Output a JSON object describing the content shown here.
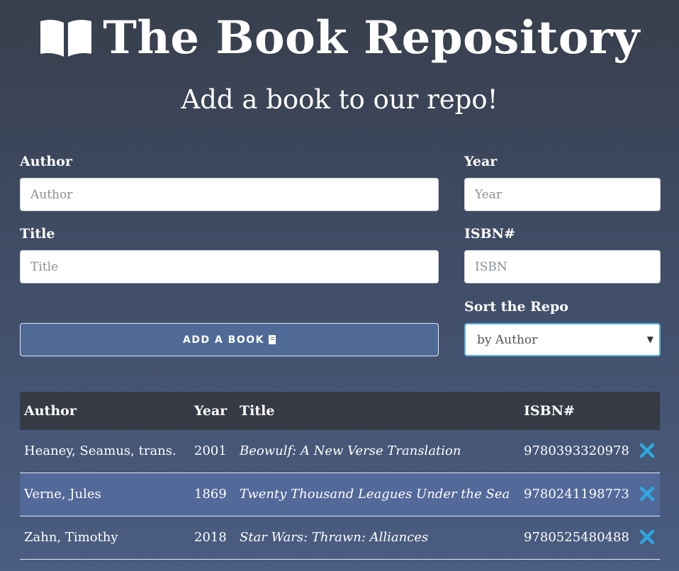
{
  "header": {
    "title": "The Book Repository",
    "subtitle": "Add a book to our repo!",
    "icon": "open-book-icon"
  },
  "form": {
    "author": {
      "label": "Author",
      "placeholder": "Author",
      "value": ""
    },
    "year": {
      "label": "Year",
      "placeholder": "Year",
      "value": ""
    },
    "title": {
      "label": "Title",
      "placeholder": "Title",
      "value": ""
    },
    "isbn": {
      "label": "ISBN#",
      "placeholder": "ISBN",
      "value": ""
    },
    "sort": {
      "label": "Sort the Repo",
      "selected": "by Author"
    },
    "add_button": "ADD A BOOK"
  },
  "table": {
    "headers": {
      "author": "Author",
      "year": "Year",
      "title": "Title",
      "isbn": "ISBN#"
    },
    "rows": [
      {
        "author": "Heaney, Seamus, trans.",
        "year": "2001",
        "title": "Beowulf: A New Verse Translation",
        "isbn": "9780393320978"
      },
      {
        "author": "Verne, Jules",
        "year": "1869",
        "title": "Twenty Thousand Leagues Under the Sea",
        "isbn": "9780241198773"
      },
      {
        "author": "Zahn, Timothy",
        "year": "2018",
        "title": "Star Wars: Thrawn: Alliances",
        "isbn": "9780525480488"
      }
    ]
  },
  "colors": {
    "accent": "#2ca8de",
    "header_row": "#353a45",
    "highlight_row": "#52699a"
  }
}
